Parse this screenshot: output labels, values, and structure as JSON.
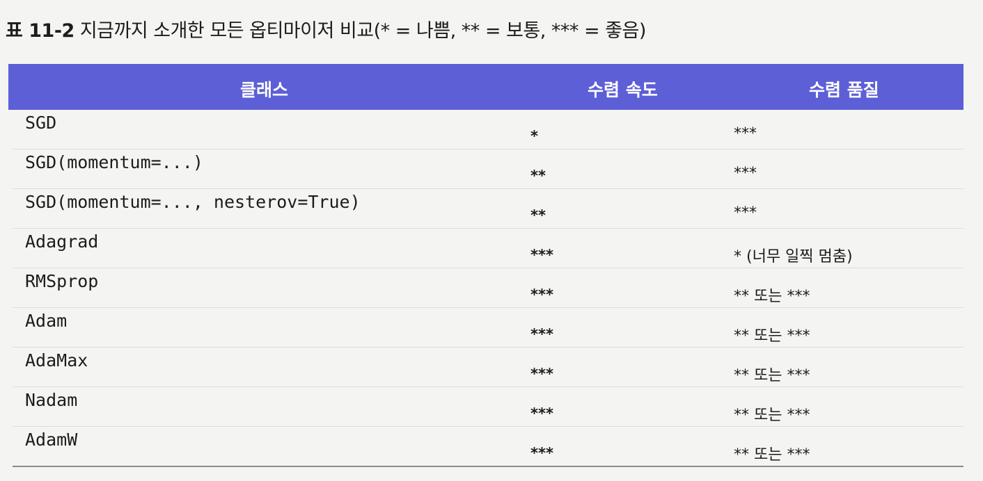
{
  "caption": {
    "label": "표 11-2",
    "text": "지금까지 소개한 모든 옵티마이저 비교(* = 나쁨, ** = 보통, *** = 좋음)"
  },
  "table": {
    "headers": {
      "class": "클래스",
      "speed": "수렴 속도",
      "quality": "수렴 품질"
    },
    "rows": [
      {
        "name": "SGD",
        "speed": "*",
        "quality": "***"
      },
      {
        "name": "SGD(momentum=...)",
        "speed": "**",
        "quality": "***"
      },
      {
        "name": "SGD(momentum=..., nesterov=True)",
        "speed": "**",
        "quality": "***"
      },
      {
        "name": "Adagrad",
        "speed": "***",
        "quality": "* (너무 일찍 멈춤)"
      },
      {
        "name": "RMSprop",
        "speed": "***",
        "quality": "** 또는 ***"
      },
      {
        "name": "Adam",
        "speed": "***",
        "quality": "** 또는 ***"
      },
      {
        "name": "AdaMax",
        "speed": "***",
        "quality": "** 또는 ***"
      },
      {
        "name": "Nadam",
        "speed": "***",
        "quality": "** 또는 ***"
      },
      {
        "name": "AdamW",
        "speed": "***",
        "quality": "** 또는 ***"
      }
    ]
  }
}
